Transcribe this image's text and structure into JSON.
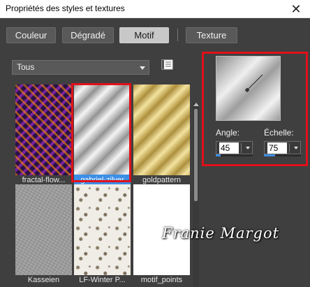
{
  "window": {
    "title": "Propriétés des styles et textures"
  },
  "tabs": [
    {
      "label": "Couleur",
      "active": false
    },
    {
      "label": "Dégradé",
      "active": false
    },
    {
      "label": "Motif",
      "active": true
    },
    {
      "label": "Texture",
      "active": false
    }
  ],
  "category_select": {
    "value": "Tous"
  },
  "patterns": [
    {
      "name": "fractal-flow...",
      "selected": false
    },
    {
      "name": "gabriel-zilver",
      "selected": true
    },
    {
      "name": "goldpattern",
      "selected": false
    },
    {
      "name": "Kasseien",
      "selected": false
    },
    {
      "name": "LF-Winter P...",
      "selected": false
    },
    {
      "name": "motif_points",
      "selected": false
    }
  ],
  "params": {
    "angle": {
      "label": "Angle:",
      "value": "45",
      "fraction": 0.125
    },
    "scale": {
      "label": "Échelle:",
      "value": "75",
      "fraction": 0.3
    }
  },
  "watermark": "Franie Margot",
  "colors": {
    "accent": "#3c8ee6",
    "highlight": "#e0101a",
    "panel": "#3f3f3f"
  }
}
